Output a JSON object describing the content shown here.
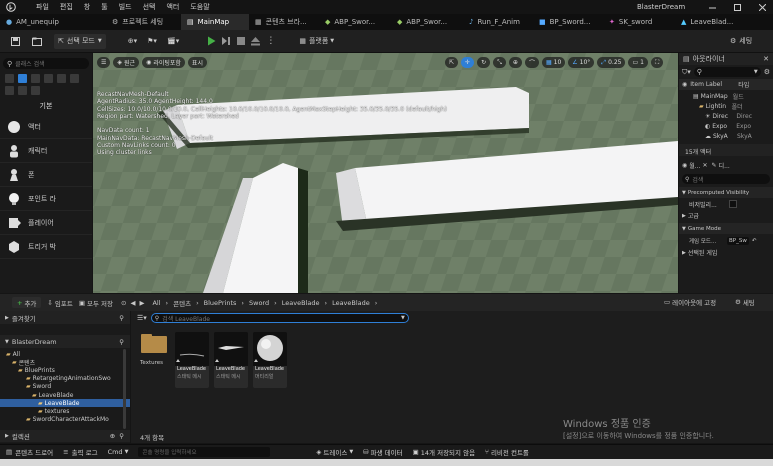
{
  "window": {
    "menu": [
      "파일",
      "편집",
      "창",
      "툴",
      "빌드",
      "선택",
      "액터",
      "도움말"
    ],
    "project_name": "BlasterDream"
  },
  "tabs": [
    {
      "label": "AM_unequip"
    },
    {
      "label": "프로젝트 세팅"
    },
    {
      "label": "MainMap"
    },
    {
      "label": "콘텐츠 브라..."
    },
    {
      "label": "ABP_Swor..."
    },
    {
      "label": "ABP_Swor..."
    },
    {
      "label": "Run_F_Anim"
    },
    {
      "label": "BP_Sword..."
    },
    {
      "label": "SK_sword"
    },
    {
      "label": "LeaveBlad..."
    }
  ],
  "toolbar": {
    "mode_label": "선택 모드",
    "platforms_label": "플랫폼",
    "settings_label": "세팅"
  },
  "left_panel": {
    "search_placeholder": "클래스 검색",
    "category_label": "기본",
    "items": [
      "액터",
      "캐릭터",
      "폰",
      "포인트 라",
      "플레이어",
      "트리거 박"
    ]
  },
  "viewport": {
    "view_label": "원근",
    "lit_label": "라이팅포함",
    "show_label": "표시",
    "grid_snap": "10",
    "rot_snap": "10°",
    "scale_snap": "0.25",
    "cam_speed": "1",
    "navmesh_lines": [
      "RecastNavMesh-Default",
      "AgentRadius: 35.0  AgentHeight: 144.0",
      "CellSizes: 10.0/10.0/10.0/10.0, CellHeights: 10.0/10.0/10.0/10.0, AgentMaxStepHeight: 35.0/35.0/35.0 (default/high)",
      "Region part: Watershed, Layer part: Watershed",
      "",
      "NavData count: 1",
      "MainNavData: RecastNavMesh-Default",
      "Custom NavLinks count: 0",
      "Using cluster links"
    ]
  },
  "outliner": {
    "title": "아웃라이너",
    "col_item": "Item Label",
    "col_type": "타입",
    "rows": [
      {
        "label": "MainMap",
        "type": "월드"
      },
      {
        "label": "Lightin",
        "type": "폴더"
      },
      {
        "label": "Direc",
        "type": "Direc"
      },
      {
        "label": "Expo",
        "type": "Expo"
      },
      {
        "label": "SkyA",
        "type": "SkyA"
      }
    ],
    "actor_count": "15개 액터"
  },
  "details": {
    "tab_details": "디테일",
    "tab_world": "월...",
    "tab_other": "디...",
    "search_placeholder": "검색",
    "section_precomputed": "Precomputed Visibility",
    "precomputed_row": "비저빌리...",
    "section_advanced": "고급",
    "section_game_mode": "Game Mode",
    "game_mode_label": "게임 모드...",
    "game_mode_value": "BP_Sw",
    "section_selected": "선택된 게임"
  },
  "content_browser": {
    "add_label": "추가",
    "import_label": "임포트",
    "save_all_label": "모두 저장",
    "breadcrumb": [
      "All",
      "콘텐츠",
      "BluePrints",
      "Sword",
      "LeaveBlade",
      "LeaveBlade"
    ],
    "layout_label": "레이아웃에 고정",
    "settings_label": "세팅",
    "favorites_label": "즐겨찾기",
    "project_label": "BlasterDream",
    "tree": [
      {
        "label": "All",
        "depth": 0
      },
      {
        "label": "콘텐츠",
        "depth": 1
      },
      {
        "label": "BluePrints",
        "depth": 2
      },
      {
        "label": "RetargetingAnimationSwo",
        "depth": 3
      },
      {
        "label": "Sword",
        "depth": 3
      },
      {
        "label": "LeaveBlade",
        "depth": 4
      },
      {
        "label": "LeaveBlade",
        "depth": 5,
        "selected": true
      },
      {
        "label": "textures",
        "depth": 4
      },
      {
        "label": "SwordCharacterAttackMo",
        "depth": 3
      }
    ],
    "collections_label": "컬렉션",
    "search_placeholder": "검색 LeaveBlade",
    "folder_label": "Textures",
    "assets": [
      {
        "name": "LeaveBlade",
        "type": "스태틱 메시"
      },
      {
        "name": "LeaveBlade",
        "type": "스태틱 메시"
      },
      {
        "name": "LeaveBlade",
        "type": "머티리얼"
      }
    ],
    "item_count": "4개 항목"
  },
  "statusbar": {
    "content_drawer": "콘텐츠 드로어",
    "output_log": "출력 로그",
    "cmd_label": "Cmd",
    "cmd_placeholder": "콘솔 명령을 입력하세요",
    "trace_label": "트레이스",
    "derived_data": "파생 데이터",
    "unsaved": "14개 저장되지 않음",
    "revision": "리비전 컨트롤"
  },
  "watermark": {
    "line1": "Windows 정품 인증",
    "line2": "[설정]으로 이동하여 Windows를 정품 인증합니다."
  }
}
